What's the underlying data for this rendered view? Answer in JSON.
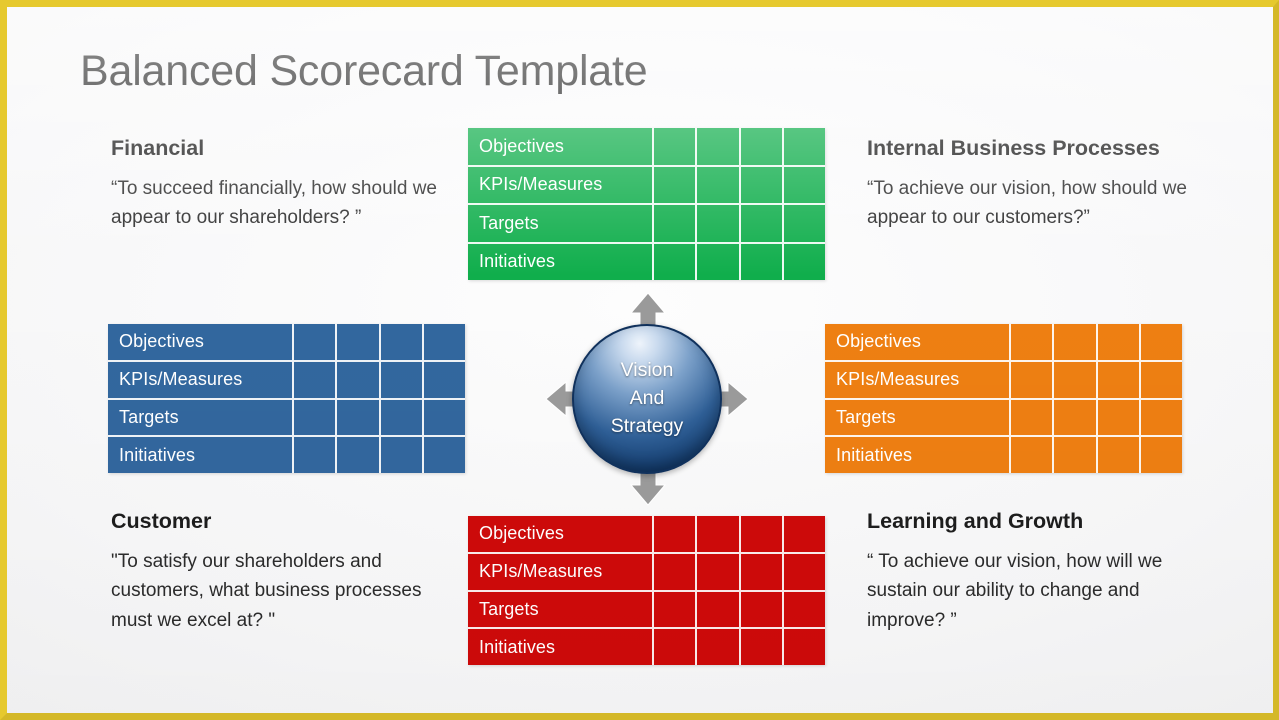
{
  "slide": {
    "title": "Balanced Scorecard Template",
    "frame_color": "#E6C92E",
    "background_color": "#F4F4F5"
  },
  "center": {
    "label": "Vision\nAnd\nStrategy",
    "circle_color": "#2F5F96",
    "arrow_color": "#9A9A9A",
    "arrows": [
      "arrow-up",
      "arrow-right",
      "arrow-down",
      "arrow-left"
    ]
  },
  "row_labels": [
    "Objectives",
    "KPIs/Measures",
    "Targets",
    "Initiatives"
  ],
  "blank_column_count": 4,
  "quadrants": [
    {
      "id": "financial",
      "heading": "Financial",
      "quote": "“To succeed financially, how should we appear to our shareholders? ”",
      "table_color": "#10AE4C"
    },
    {
      "id": "internal",
      "heading": "Internal Business Processes",
      "quote": "“To achieve our vision, how should we appear to our customers?”",
      "table_color": "#EE7F12"
    },
    {
      "id": "customer",
      "heading": "Customer",
      "quote": "\"To satisfy our shareholders and customers, what business processes must we excel at? \"",
      "table_color": "#32679E"
    },
    {
      "id": "learning",
      "heading": "Learning and Growth",
      "quote": "“ To achieve our vision, how will we sustain our ability to change and improve? ”",
      "table_color": "#CE0A0A"
    }
  ]
}
